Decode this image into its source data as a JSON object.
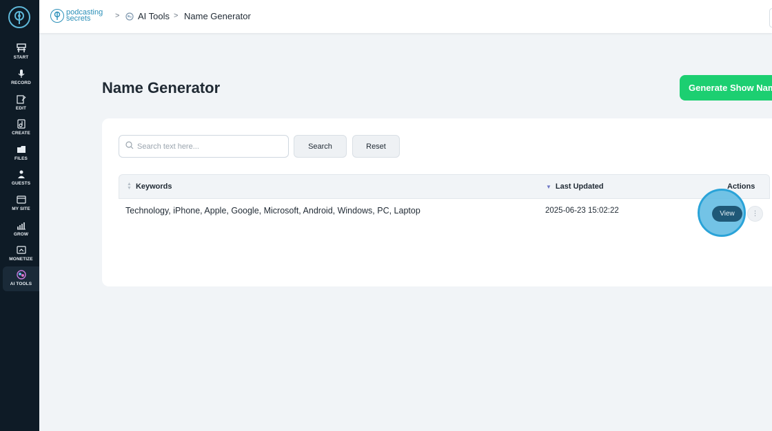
{
  "sidebar": {
    "items": [
      {
        "label": "START",
        "icon": "start-icon"
      },
      {
        "label": "RECORD",
        "icon": "microphone-icon"
      },
      {
        "label": "EDIT",
        "icon": "edit-icon"
      },
      {
        "label": "CREATE",
        "icon": "create-icon"
      },
      {
        "label": "FILES",
        "icon": "files-icon"
      },
      {
        "label": "GUESTS",
        "icon": "guests-icon"
      },
      {
        "label": "MY SITE",
        "icon": "site-icon"
      },
      {
        "label": "GROW",
        "icon": "grow-icon"
      },
      {
        "label": "MONETIZE",
        "icon": "monetize-icon"
      },
      {
        "label": "AI TOOLS",
        "icon": "ai-tools-icon"
      }
    ],
    "active": "AI TOOLS"
  },
  "header": {
    "brand_line1": "podcasting",
    "brand_line2": "secrets",
    "breadcrumb": [
      "AI Tools",
      "Name Generator"
    ]
  },
  "main": {
    "title": "Name Generator",
    "generate_button": "Generate Show Nam",
    "search": {
      "placeholder": "Search text here...",
      "value": ""
    },
    "search_button": "Search",
    "reset_button": "Reset",
    "table": {
      "columns": [
        "Keywords",
        "Last Updated",
        "Actions"
      ],
      "rows": [
        {
          "keywords": "Technology, iPhone, Apple, Google, Microsoft, Android, Windows, PC, Laptop",
          "last_updated": "2025-06-23 15:02:22",
          "action": "View"
        }
      ]
    }
  },
  "colors": {
    "sidebar_bg": "#0e1b26",
    "accent_green": "#1ccf71",
    "brand_blue": "#2a8fb8",
    "view_button": "#1f5877"
  }
}
